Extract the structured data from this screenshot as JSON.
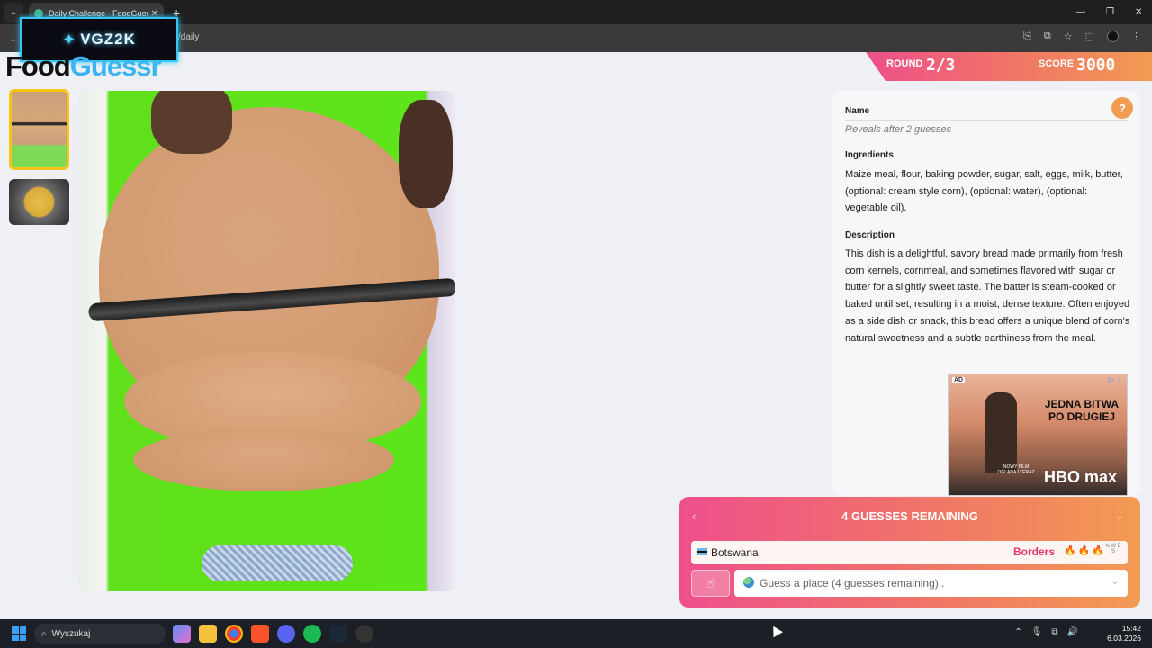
{
  "browser": {
    "tab_title": "Daily Challenge - FoodGuessr |",
    "tab_close": "✕",
    "new_tab": "+",
    "url_suffix": "/daily",
    "win_minimize": "—",
    "win_restore": "❐",
    "win_close": "✕"
  },
  "overlay": {
    "logo_text": "VGZ2K"
  },
  "site": {
    "logo_part1": "Food",
    "logo_part2": "Guessr"
  },
  "header": {
    "round_label": "ROUND",
    "round_value": "2/3",
    "score_label": "SCORE",
    "score_value": "3000"
  },
  "images": {
    "thumbnails": [
      "thumbnail-1-selected",
      "thumbnail-2"
    ]
  },
  "panel": {
    "help": "?",
    "name_title": "Name",
    "name_value": "Reveals after 2 guesses",
    "ingredients_title": "Ingredients",
    "ingredients_text": "Maize meal, flour, baking powder, sugar, salt, eggs, milk, butter, (optional: cream style corn), (optional: water), (optional: vegetable oil).",
    "description_title": "Description",
    "description_text": "This dish is a delightful, savory bread made primarily from fresh corn kernels, cornmeal, and sometimes flavored with sugar or butter for a slightly sweet taste. The batter is steam-cooked or baked until set, resulting in a moist, dense texture. Often enjoyed as a side dish or snack, this bread offers a unique blend of corn's natural sweetness and a subtle earthiness from the meal."
  },
  "ad": {
    "label": "AD",
    "choices": "▷ ⋮",
    "headline": "JEDNA BITWA PO DRUGIEJ",
    "small_text": "NOWY FILM OGLĄDAJ TERAZ",
    "brand": "HBO max"
  },
  "guess": {
    "remaining_title": "4 GUESSES REMAINING",
    "previous_guesses": [
      {
        "country": "Botswana",
        "hint": "Borders",
        "flames": "🔥🔥🔥"
      }
    ],
    "compass": "N W E S",
    "input_placeholder": "Guess a place (4 guesses remaining)..",
    "hint_button": "☝"
  },
  "taskbar": {
    "search_label": "Wyszukaj",
    "time": "15:42",
    "date": "6.03.2026"
  },
  "colors": {
    "accent_gradient_start": "#ee4f8b",
    "accent_gradient_end": "#f29b52",
    "logo_blue": "#3bb4f2",
    "thumb_selected_border": "#f5c518"
  }
}
